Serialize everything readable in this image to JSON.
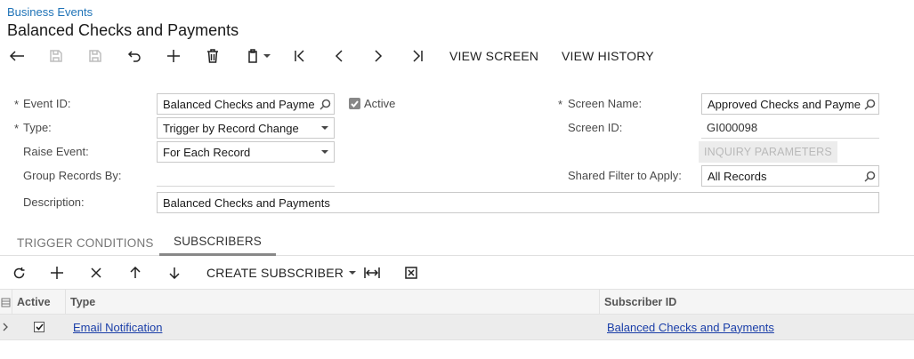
{
  "breadcrumb": "Business Events",
  "title": "Balanced Checks and Payments",
  "toolbar": {
    "view_screen": "VIEW SCREEN",
    "view_history": "VIEW HISTORY"
  },
  "form": {
    "event_id_label": "Event ID:",
    "event_id_value": "Balanced Checks and Payme",
    "active_label": "Active",
    "active_checked": true,
    "type_label": "Type:",
    "type_value": "Trigger by Record Change",
    "raise_event_label": "Raise Event:",
    "raise_event_value": "For Each Record",
    "group_records_label": "Group Records By:",
    "group_records_value": "",
    "description_label": "Description:",
    "description_value": "Balanced Checks and Payments",
    "screen_name_label": "Screen Name:",
    "screen_name_value": "Approved Checks and Payme",
    "screen_id_label": "Screen ID:",
    "screen_id_value": "GI000098",
    "inquiry_params_label": "INQUIRY PARAMETERS",
    "shared_filter_label": "Shared Filter to Apply:",
    "shared_filter_value": "All Records",
    "required_marker": "*"
  },
  "tabs": [
    {
      "label": "TRIGGER CONDITIONS",
      "active": false
    },
    {
      "label": "SUBSCRIBERS",
      "active": true
    }
  ],
  "grid_toolbar": {
    "create_subscriber": "CREATE SUBSCRIBER"
  },
  "grid": {
    "columns": [
      "Active",
      "Type",
      "Subscriber ID"
    ],
    "rows": [
      {
        "active": true,
        "type": "Email Notification",
        "subscriber_id": "Balanced Checks and Payments"
      }
    ]
  },
  "icons": {
    "back": "back-arrow-icon",
    "save_close": "save-close-icon",
    "save": "save-icon",
    "undo": "undo-icon",
    "add": "plus-icon",
    "delete": "trash-icon",
    "clipboard": "clipboard-icon",
    "first": "first-record-icon",
    "prev": "prev-record-icon",
    "next": "next-record-icon",
    "last": "last-record-icon"
  }
}
